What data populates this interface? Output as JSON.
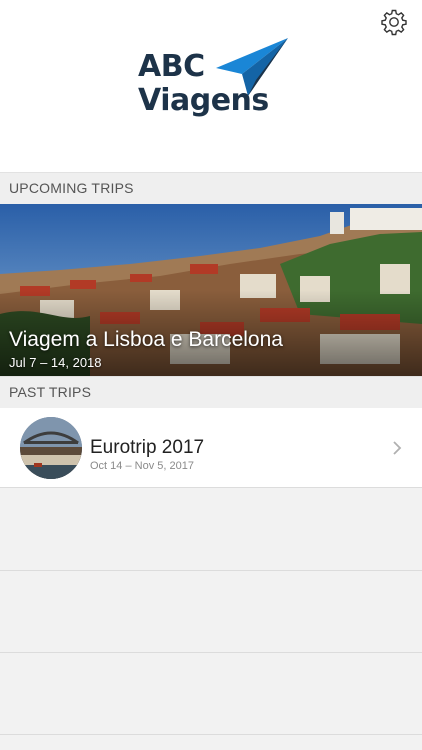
{
  "header": {
    "logo_line1": "ABC",
    "logo_line2": "Viagens"
  },
  "icons": {
    "settings": "gear-icon",
    "logo": "paper-plane-icon",
    "chevron": "chevron-right-icon"
  },
  "colors": {
    "logo_text": "#1d3349",
    "logo_plane": "#1a86d6",
    "section_bg": "#efefef",
    "background": "#f2f2f2"
  },
  "upcoming": {
    "header": "UPCOMING TRIPS",
    "trip": {
      "title": "Viagem a Lisboa e Barcelona",
      "dates": "Jul 7 – 14, 2018"
    }
  },
  "past": {
    "header": "PAST TRIPS",
    "trips": [
      {
        "name": "Eurotrip 2017",
        "dates": "Oct 14 – Nov 5, 2017"
      }
    ]
  }
}
